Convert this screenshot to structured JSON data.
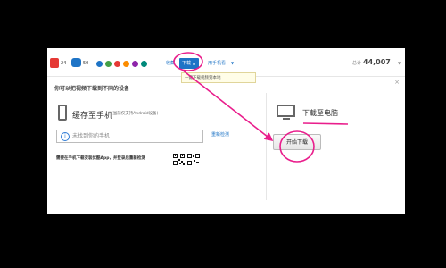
{
  "toolbar": {
    "like_count": "24",
    "comment_count": "50",
    "fav_label": "收藏",
    "download_label": "下载",
    "download_caret": "▲",
    "phone_watch_label": "用手机看",
    "phone_watch_caret": "▼",
    "total_label": "总计",
    "total_count": "44,007",
    "caret_right": "▼"
  },
  "tooltip": {
    "text": "一键下载视频到本地"
  },
  "dialog": {
    "title": "你可以把视频下载到不同的设备",
    "close_label": "×",
    "phone": {
      "title": "缓存至手机",
      "subtitle": "(当前仅支持Android设备)",
      "placeholder": "未找到你的手机",
      "info_glyph": "i",
      "redetect_label": "重新检测",
      "app_note": "需要在手机下载安装优酷App，并登录后重新检测"
    },
    "pc": {
      "title": "下载至电脑",
      "start_button": "开始下载"
    }
  },
  "colors": {
    "annotation": "#e91e8c",
    "link": "#1e74c6",
    "download_tab_bg": "#1e74c6",
    "tooltip_bg": "#fffde7"
  }
}
